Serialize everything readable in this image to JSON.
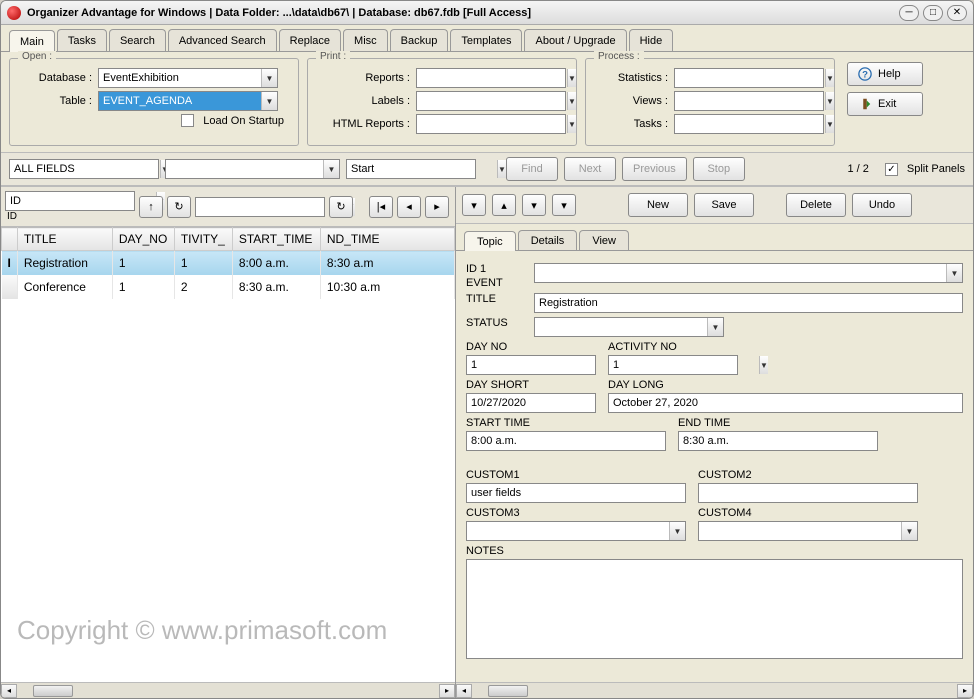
{
  "title": "Organizer Advantage for Windows | Data Folder: ...\\data\\db67\\ | Database: db67.fdb [Full Access]",
  "main_tabs": [
    "Main",
    "Tasks",
    "Search",
    "Advanced Search",
    "Replace",
    "Misc",
    "Backup",
    "Templates",
    "About / Upgrade",
    "Hide"
  ],
  "main_tab_active": 0,
  "open": {
    "group": "Open :",
    "database_label": "Database :",
    "database_value": "EventExhibition",
    "table_label": "Table :",
    "table_value": "EVENT_AGENDA",
    "load_on_startup_label": "Load On Startup",
    "load_on_startup_checked": false
  },
  "print": {
    "group": "Print :",
    "reports_label": "Reports :",
    "labels_label": "Labels :",
    "html_reports_label": "HTML Reports :"
  },
  "process": {
    "group": "Process :",
    "statistics_label": "Statistics :",
    "views_label": "Views :",
    "tasks_label": "Tasks :"
  },
  "help_button": "Help",
  "exit_button": "Exit",
  "filter": {
    "field": "ALL FIELDS",
    "value": "",
    "mode": "Start",
    "find": "Find",
    "next": "Next",
    "previous": "Previous",
    "stop": "Stop",
    "counter": "1 / 2",
    "split_panels": "Split Panels",
    "split_checked": true
  },
  "sort": {
    "col1": "ID",
    "col1_sub": "ID",
    "col2": ""
  },
  "grid": {
    "columns": [
      "",
      "TITLE",
      "DAY_NO",
      "TIVITY_",
      "START_TIME",
      "ND_TIME"
    ],
    "rows": [
      {
        "marker": "I",
        "title": "Registration",
        "day_no": "1",
        "activity": "1",
        "start": "8:00 a.m.",
        "end": "8:30 a.m",
        "selected": true
      },
      {
        "marker": "",
        "title": "Conference",
        "day_no": "1",
        "activity": "2",
        "start": "8:30 a.m.",
        "end": "10:30 a.m",
        "selected": false
      }
    ]
  },
  "right_buttons": {
    "new": "New",
    "save": "Save",
    "delete": "Delete",
    "undo": "Undo"
  },
  "subtabs": [
    "Topic",
    "Details",
    "View"
  ],
  "subtab_active": 0,
  "form": {
    "id_label": "ID 1",
    "event_label": "EVENT",
    "event_value": "",
    "title_label": "TITLE",
    "title_value": "Registration",
    "status_label": "STATUS",
    "status_value": "",
    "day_no_label": "DAY NO",
    "day_no_value": "1",
    "activity_no_label": "ACTIVITY NO",
    "activity_no_value": "1",
    "day_short_label": "DAY SHORT",
    "day_short_value": "10/27/2020",
    "day_long_label": "DAY LONG",
    "day_long_value": "October 27, 2020",
    "start_time_label": "START TIME",
    "start_time_value": "8:00 a.m.",
    "end_time_label": "END TIME",
    "end_time_value": "8:30 a.m.",
    "custom1_label": "CUSTOM1",
    "custom1_value": "user fields",
    "custom2_label": "CUSTOM2",
    "custom2_value": "",
    "custom3_label": "CUSTOM3",
    "custom3_value": "",
    "custom4_label": "CUSTOM4",
    "custom4_value": "",
    "notes_label": "NOTES",
    "notes_value": ""
  },
  "watermark": "Copyright ©  www.primasoft.com"
}
